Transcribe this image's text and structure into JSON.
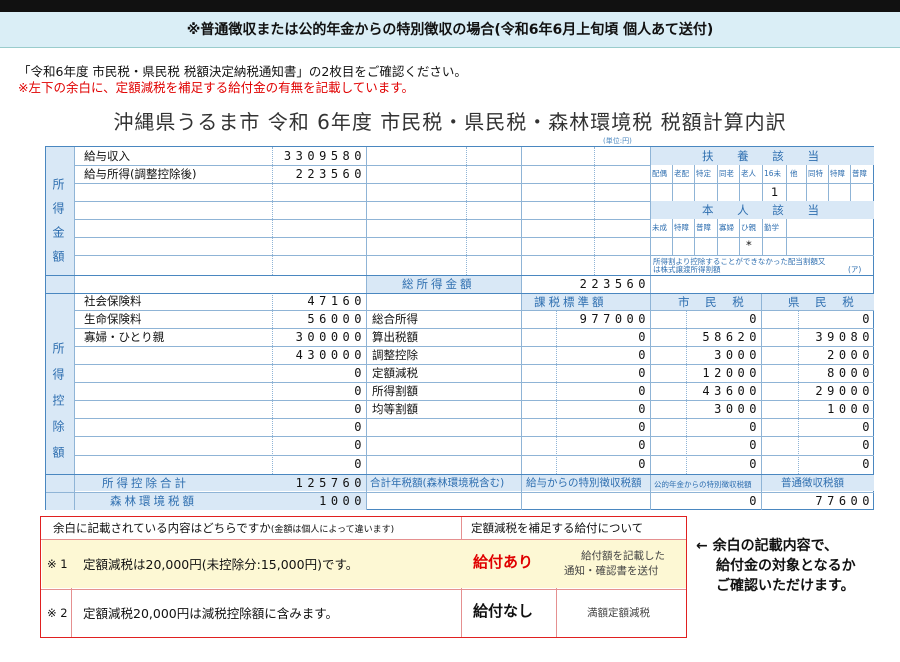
{
  "banner": "※普通徴収または公的年金からの特別徴収の場合(令和6年6月上旬頃 個人あて送付)",
  "notes": [
    "「令和6年度 市民税・県民税 税額決定納税通知書」の2枚目をご確認ください。",
    "※左下の余白に、定額減税を補足する給付金の有無を記載しています。"
  ],
  "title": "沖縄県うるま市 令和 6年度 市民税・県民税・森林環境税 税額計算内訳",
  "unit": "(単位:円)",
  "income": {
    "section_label": "所得金額",
    "rows": [
      {
        "label": "給与収入",
        "value": "3309580"
      },
      {
        "label": "給与所得(調整控除後)",
        "value": "223560"
      }
    ],
    "total_label": "総所得金額",
    "total_value": "223560"
  },
  "fuyou": {
    "header": "扶 養 該 当",
    "cols": [
      "配偶",
      "老配",
      "特定",
      "同老",
      "老人",
      "16未",
      "他",
      "同特",
      "特障",
      "普障"
    ],
    "value_16": "1"
  },
  "honnin": {
    "header": "本 人 該 当",
    "cols": [
      "未成",
      "特障",
      "普障",
      "寡婦",
      "ひ親",
      "勤学"
    ],
    "mark": "*",
    "note1": "所得割より控除することができなかった配当割額又",
    "note2": "は株式譲渡所得割額",
    "note_suffix": "(ア)"
  },
  "deduction": {
    "section_label": "所得控除額",
    "rows": [
      {
        "label": "社会保険料",
        "value": "47160"
      },
      {
        "label": "生命保険料",
        "value": "56000"
      },
      {
        "label": "寡婦・ひとり親",
        "value": "300000"
      },
      {
        "label": "",
        "value": "430000"
      },
      {
        "label": "",
        "value": "0"
      },
      {
        "label": "",
        "value": "0"
      },
      {
        "label": "",
        "value": "0"
      },
      {
        "label": "",
        "value": "0"
      },
      {
        "label": "",
        "value": "0"
      },
      {
        "label": "",
        "value": "0"
      }
    ],
    "total_label": "所得控除合計",
    "total_value": "125760",
    "forest_label": "森林環境税額",
    "forest_value": "1000"
  },
  "tax": {
    "h_kijun": "課税標準額",
    "h_shi": "市 民 税",
    "h_ken": "県 民 税",
    "rows": [
      {
        "label": "総合所得",
        "kijun": "977000",
        "shi": "0",
        "ken": "0"
      },
      {
        "label": "算出税額",
        "kijun": "0",
        "shi": "58620",
        "ken": "39080"
      },
      {
        "label": "調整控除",
        "kijun": "0",
        "shi": "3000",
        "ken": "2000"
      },
      {
        "label": "定額減税",
        "kijun": "0",
        "shi": "12000",
        "ken": "8000"
      },
      {
        "label": "所得割額",
        "kijun": "0",
        "shi": "43600",
        "ken": "29000"
      },
      {
        "label": "均等割額",
        "kijun": "0",
        "shi": "3000",
        "ken": "1000"
      },
      {
        "label": "",
        "kijun": "0",
        "shi": "0",
        "ken": "0"
      },
      {
        "label": "",
        "kijun": "0",
        "shi": "0",
        "ken": "0"
      },
      {
        "label": "",
        "kijun": "0",
        "shi": "0",
        "ken": "0"
      }
    ],
    "footer_labels": [
      "合計年税額(森林環境税含む)",
      "給与からの特別徴収税額",
      "公的年金からの特別徴収税額",
      "普通徴収税額"
    ],
    "footer_values": [
      "",
      "",
      "0",
      "77600"
    ]
  },
  "margin_box": {
    "q": "余白に記載されている内容はどちらですか",
    "q_small": "(金額は個人によって違います)",
    "h2": "定額減税を補足する給付について",
    "rows": [
      {
        "mark": "※ 1",
        "text": "定額減税は20,000円(未控除分:15,000円)です。",
        "result": "給付あり",
        "note1": "給付額を記載した",
        "note2": "通知・確認書を送付"
      },
      {
        "mark": "※ 2",
        "text": "定額減税20,000円は減税控除額に含みます。",
        "result": "給付なし",
        "note1": "満額定額減税",
        "note2": ""
      }
    ]
  },
  "side_note": [
    "← 余白の記載内容で、",
    "給付金の対象となるか",
    "ご確認いただけます。"
  ]
}
